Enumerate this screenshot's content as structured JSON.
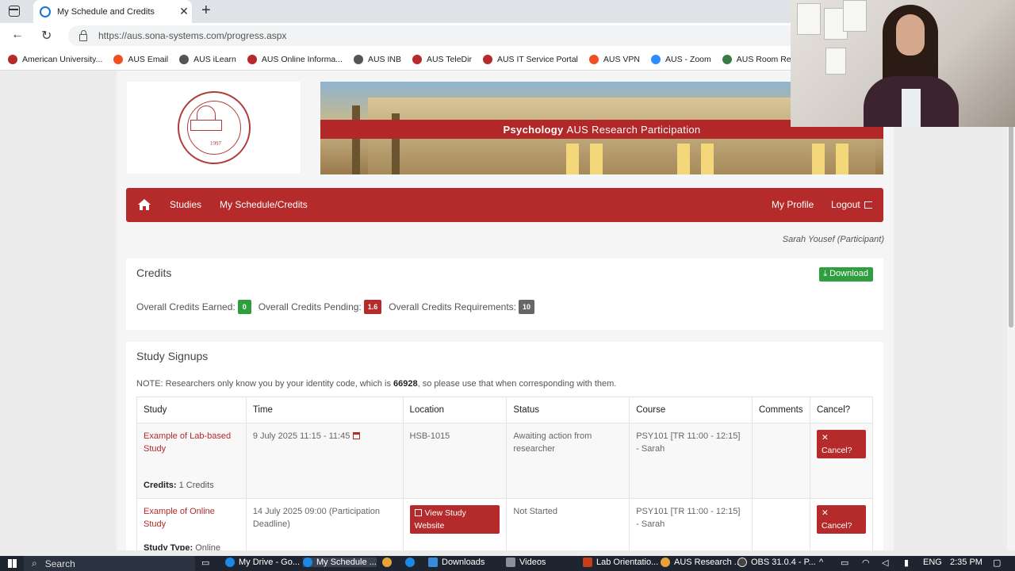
{
  "browser": {
    "tab_title": "My Schedule and Credits",
    "url": "https://aus.sona-systems.com/progress.aspx",
    "bookmarks": [
      {
        "label": "American University...",
        "color": "#b52a2a"
      },
      {
        "label": "AUS Email",
        "color": "#f25022"
      },
      {
        "label": "AUS iLearn",
        "color": "#555555"
      },
      {
        "label": "AUS Online Informa...",
        "color": "#b52a2a"
      },
      {
        "label": "AUS INB",
        "color": "#555555"
      },
      {
        "label": "AUS TeleDir",
        "color": "#b52a2a"
      },
      {
        "label": "AUS IT Service Portal",
        "color": "#b52a2a"
      },
      {
        "label": "AUS VPN",
        "color": "#f25022"
      },
      {
        "label": "AUS - Zoom",
        "color": "#2d8cff"
      },
      {
        "label": "AUS Room Reservat...",
        "color": "#3a7d44"
      }
    ]
  },
  "header": {
    "seal_year": "1997",
    "banner_bold": "Psychology",
    "banner_text": "AUS Research Participation"
  },
  "nav": {
    "studies": "Studies",
    "schedule": "My Schedule/Credits",
    "profile": "My Profile",
    "logout": "Logout"
  },
  "participant": "Sarah Yousef (Participant)",
  "credits": {
    "title": "Credits",
    "download": "Download",
    "earned_label": "Overall Credits Earned:",
    "earned": "0",
    "pending_label": "Overall Credits Pending:",
    "pending": "1.6",
    "required_label": "Overall Credits Requirements:",
    "required": "10",
    "colors": {
      "earned": "#2e9e3e",
      "pending": "#b52a2a",
      "required": "#666666"
    }
  },
  "signups": {
    "title": "Study Signups",
    "note_pre": "NOTE: Researchers only know you by your identity code, which is",
    "code": "66928",
    "note_post": ", so please use that when corresponding with them.",
    "columns": [
      "Study",
      "Time",
      "Location",
      "Status",
      "Course",
      "Comments",
      "Cancel?"
    ],
    "rows": [
      {
        "study": "Example of Lab-based Study",
        "credits_label": "Credits:",
        "credits_value": "1 Credits",
        "time": "9 July 2025 11:15 - 11:45",
        "location": "HSB-1015",
        "status": "Awaiting action from researcher",
        "course": "PSY101 [TR 11:00 - 12:15] - Sarah",
        "comments": "",
        "cancel": "Cancel?"
      },
      {
        "study": "Example of Online Study",
        "credits_label": "Study Type:",
        "credits_value": "Online",
        "time": "14 July 2025 09:00 (Participation Deadline)",
        "location_button": "View Study Website",
        "status": "Not Started",
        "course": "PSY101 [TR 11:00 - 12:15] - Sarah",
        "comments": "",
        "cancel": "Cancel?"
      }
    ]
  },
  "taskbar": {
    "search": "Search",
    "items": [
      "My Drive - Go...",
      "My Schedule ...",
      "Downloads",
      "Videos",
      "Lab Orientatio...",
      "AUS Research ...",
      "OBS 31.0.4 - P..."
    ],
    "lang": "ENG",
    "time": "2:35 PM"
  }
}
